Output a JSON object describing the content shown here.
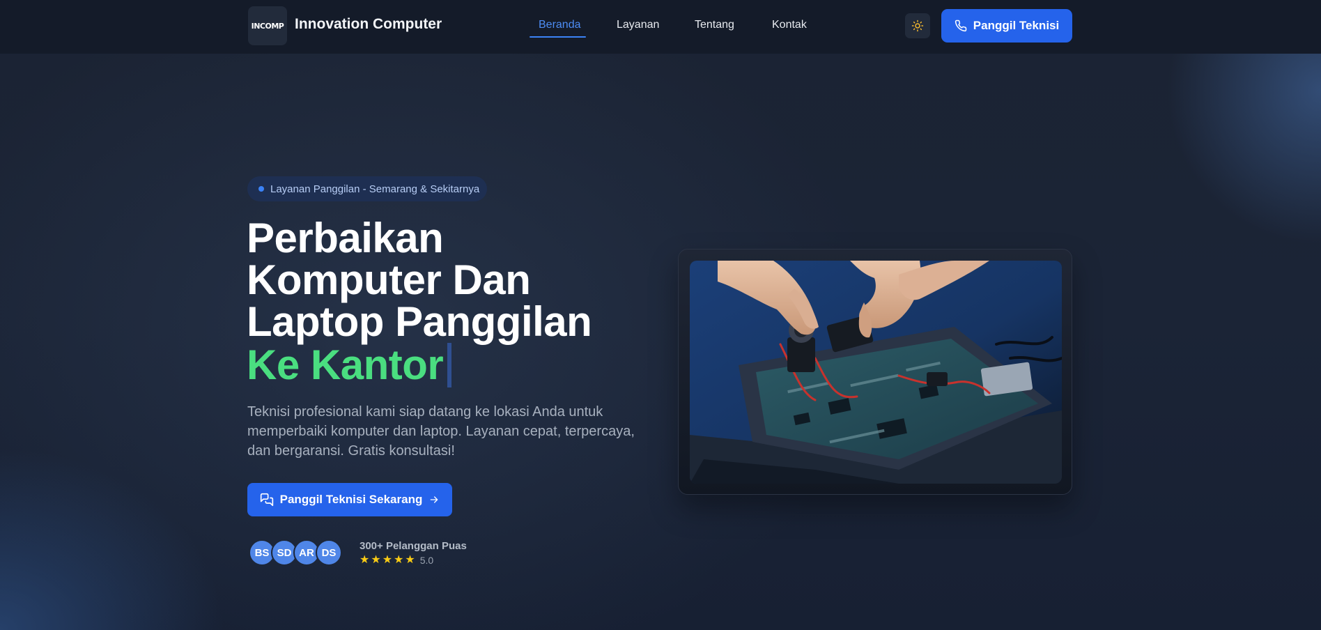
{
  "nav": {
    "logo_text": "INCOMP",
    "brand": "Innovation Computer",
    "links": [
      {
        "label": "Beranda",
        "active": true
      },
      {
        "label": "Layanan",
        "active": false
      },
      {
        "label": "Tentang",
        "active": false
      },
      {
        "label": "Kontak",
        "active": false
      }
    ],
    "theme_toggle_icon": "sun-icon",
    "call_button": {
      "label": "Panggil Teknisi",
      "icon": "phone-icon"
    }
  },
  "hero": {
    "badge": "Layanan Panggilan - Semarang & Sekitarnya",
    "title_lines": [
      "Perbaikan",
      "Komputer Dan",
      "Laptop Panggilan"
    ],
    "title_accent": "Ke Kantor",
    "description": "Teknisi profesional kami siap datang ke lokasi Anda untuk memperbaiki komputer dan laptop. Layanan cepat, terpercaya, dan bergaransi. Gratis konsultasi!",
    "cta": {
      "label": "Panggil Teknisi Sekarang",
      "icon": "chat-icon",
      "trailing_icon": "arrow-right-icon"
    },
    "social_proof": {
      "avatars": [
        "BS",
        "SD",
        "AR",
        "DS"
      ],
      "customers": "300+ Pelanggan Puas",
      "stars": 5,
      "rating": "5.0"
    },
    "image_subject": "technician-hands-repairing-laptop-motherboard"
  },
  "colors": {
    "accent": "#2563eb",
    "highlight": "#4ade80",
    "star": "#facc15",
    "nav_bg": "#141b29"
  }
}
